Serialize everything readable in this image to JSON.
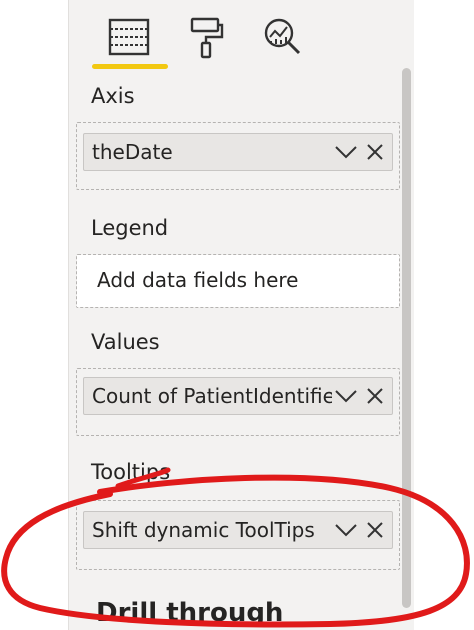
{
  "header": {
    "tabs": [
      {
        "name": "fields",
        "icon": "fields-icon",
        "active": true
      },
      {
        "name": "format",
        "icon": "paint-roller-icon",
        "active": false
      },
      {
        "name": "analytics",
        "icon": "analytics-magnifier-icon",
        "active": false
      }
    ],
    "active_color": "#f2c811"
  },
  "wells": {
    "axis": {
      "label": "Axis",
      "field": "theDate"
    },
    "legend": {
      "label": "Legend",
      "placeholder": "Add data fields here"
    },
    "values": {
      "label": "Values",
      "field": "Count of PatientIdentifie"
    },
    "tooltips": {
      "label": "Tooltips",
      "field": "Shift dynamic ToolTips"
    }
  },
  "footer": {
    "heading": "Drill through"
  },
  "annotation": {
    "color": "#e01a1a"
  }
}
